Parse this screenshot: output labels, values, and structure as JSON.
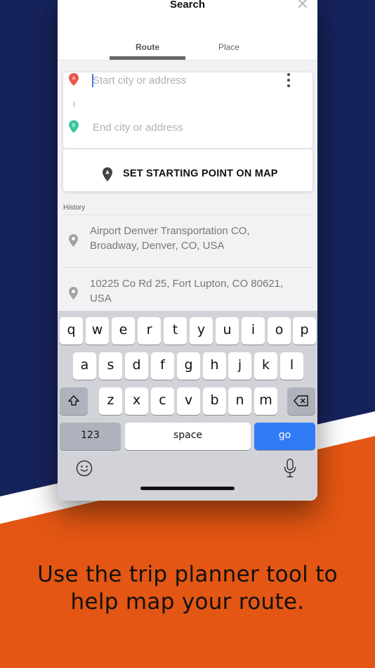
{
  "colors": {
    "navy": "#16235b",
    "orange": "#e35613",
    "accent_blue": "#2f7bf5",
    "pin_a": "#e8584c",
    "pin_b": "#3cc5a1"
  },
  "header": {
    "title": "Search",
    "close_icon": "close-icon"
  },
  "tabs": [
    {
      "label": "Route",
      "active": true
    },
    {
      "label": "Place",
      "active": false
    }
  ],
  "route": {
    "start_marker": "A",
    "end_marker": "B",
    "start_placeholder": "Start city or address",
    "end_placeholder": "End city or address",
    "more_icon": "more-vertical-icon"
  },
  "map_button": {
    "label": "SET STARTING POINT ON MAP"
  },
  "history": {
    "label": "History",
    "items": [
      {
        "line1": "Airport Denver Transportation CO,",
        "line2": "Broadway, Denver, CO, USA"
      },
      {
        "line1": "10225 Co Rd 25, Fort Lupton, CO 80621,",
        "line2": "USA"
      }
    ]
  },
  "keyboard": {
    "row1": [
      "q",
      "w",
      "e",
      "r",
      "t",
      "y",
      "u",
      "i",
      "o",
      "p"
    ],
    "row2": [
      "a",
      "s",
      "d",
      "f",
      "g",
      "h",
      "j",
      "k",
      "l"
    ],
    "row3": [
      "z",
      "x",
      "c",
      "v",
      "b",
      "n",
      "m"
    ],
    "numbers_label": "123",
    "space_label": "space",
    "go_label": "go"
  },
  "caption": {
    "line1": "Use the trip planner tool to",
    "line2": "help map your route."
  }
}
